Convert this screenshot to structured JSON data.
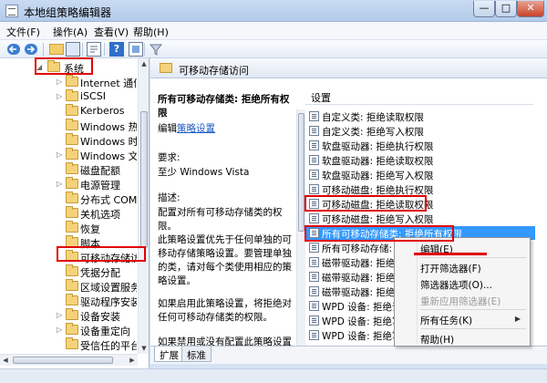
{
  "window": {
    "title": "本地组策略编辑器",
    "min": "—",
    "max": "□",
    "close": "✕"
  },
  "menu": [
    "文件(F)",
    "操作(A)",
    "查看(V)",
    "帮助(H)"
  ],
  "toolbar_icons": [
    "back-arrow-icon",
    "forward-arrow-icon",
    "up-folder-icon",
    "show-hide-console-tree-icon",
    "export-list-icon",
    "help-icon",
    "properties-icon",
    "filter-icon"
  ],
  "tree": {
    "items": [
      {
        "label": "系统",
        "expanded": true
      },
      {
        "label": "Internet 通信管"
      },
      {
        "label": "iSCSI"
      },
      {
        "label": "Kerberos"
      },
      {
        "label": "Windows 热启"
      },
      {
        "label": "Windows 时间"
      },
      {
        "label": "Windows 文件"
      },
      {
        "label": "磁盘配额"
      },
      {
        "label": "电源管理"
      },
      {
        "label": "分布式 COM"
      },
      {
        "label": "关机选项"
      },
      {
        "label": "恢复"
      },
      {
        "label": "脚本"
      },
      {
        "label": "可移动存储访问",
        "selected": true
      },
      {
        "label": "凭据分配"
      },
      {
        "label": "区域设置服务"
      },
      {
        "label": "驱动程序安装"
      },
      {
        "label": "设备安装"
      },
      {
        "label": "设备重定向"
      },
      {
        "label": "受信任的平台模"
      }
    ]
  },
  "right_pane": {
    "header": "可移动存储访问",
    "description": {
      "policy_title": "所有可移动存储类: 拒绝所有权限",
      "edit_prefix": "编辑",
      "edit_link": "策略设置",
      "requirements_label": "要求:",
      "requirements_value": "至少 Windows Vista",
      "desc_label": "描述:",
      "desc_text": "配置对所有可移动存储类的权限。",
      "para1": "此策略设置优先于任何单独的可移动存储策略设置。要管理单独的类，请对每个类使用相应的策略设置。",
      "para2": "如果启用此策略设置，将拒绝对任何可移动存储类的权限。",
      "para3": "如果禁用或没有配置此策略设置"
    },
    "column_header": "设置",
    "settings": [
      "自定义类: 拒绝读取权限",
      "自定义类: 拒绝写入权限",
      "软盘驱动器: 拒绝执行权限",
      "软盘驱动器: 拒绝读取权限",
      "软盘驱动器: 拒绝写入权限",
      "可移动磁盘: 拒绝执行权限",
      "可移动磁盘: 拒绝读取权限",
      "可移动磁盘: 拒绝写入权限",
      "所有可移动存储类: 拒绝所有权限",
      "所有可移动存储: 允",
      "磁带驱动器: 拒绝",
      "磁带驱动器: 拒绝",
      "磁带驱动器: 拒绝",
      "WPD 设备: 拒绝读",
      "WPD 设备: 拒绝写",
      "WPD 设备: 拒绝写"
    ]
  },
  "bottom_tabs": [
    "扩展",
    "标准"
  ],
  "context_menu": {
    "items": [
      "编辑(E)",
      "打开筛选器(F)",
      "筛选器选项(O)...",
      "重新应用筛选器(E)",
      "所有任务(K)",
      "帮助(H)"
    ],
    "disabled": [
      "重新应用筛选器(E)"
    ]
  },
  "scroll_arrows": {
    "up": "▲",
    "down": "▼",
    "left": "◀",
    "right": "▶"
  },
  "colors": {
    "selection": "#3399ff",
    "highlight": "#e00000",
    "link": "#1a5bc4"
  }
}
